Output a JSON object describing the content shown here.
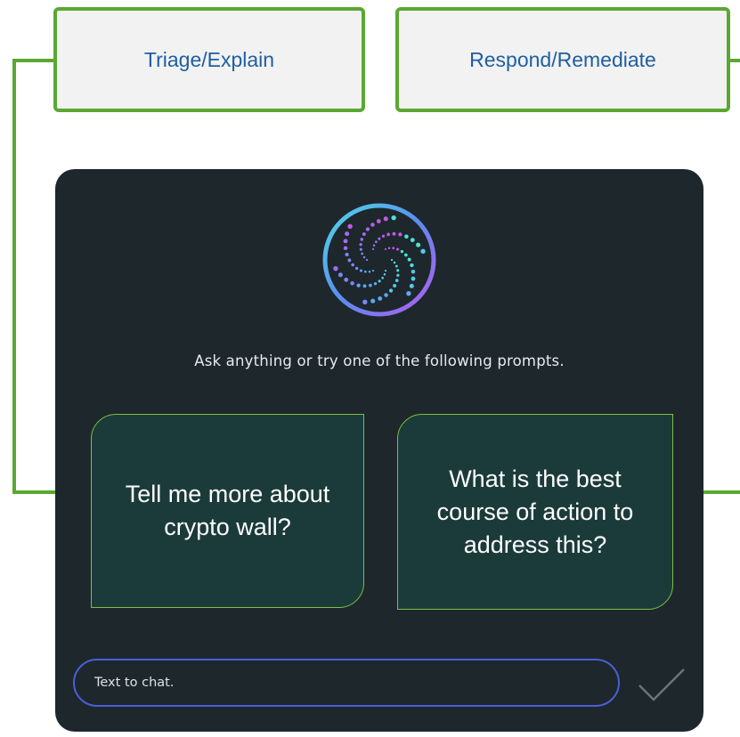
{
  "labels": {
    "triage": "Triage/Explain",
    "respond": "Respond/Remediate"
  },
  "chat": {
    "prompt_intro": "Ask anything or try one of the following prompts.",
    "suggestions": [
      {
        "text": "Tell me more about crypto wall?"
      },
      {
        "text": "What is the best course of action to address this?"
      }
    ],
    "input": {
      "placeholder": "Text to chat.",
      "value": ""
    }
  },
  "colors": {
    "accent_green": "#5aa832",
    "label_text": "#1f5fa0",
    "panel_bg": "#1e272c",
    "card_bg": "#1b3b3a",
    "input_border": "#4a5fd8"
  },
  "icons": {
    "logo": "spiral-dots-logo-icon",
    "send": "checkmark-icon"
  }
}
